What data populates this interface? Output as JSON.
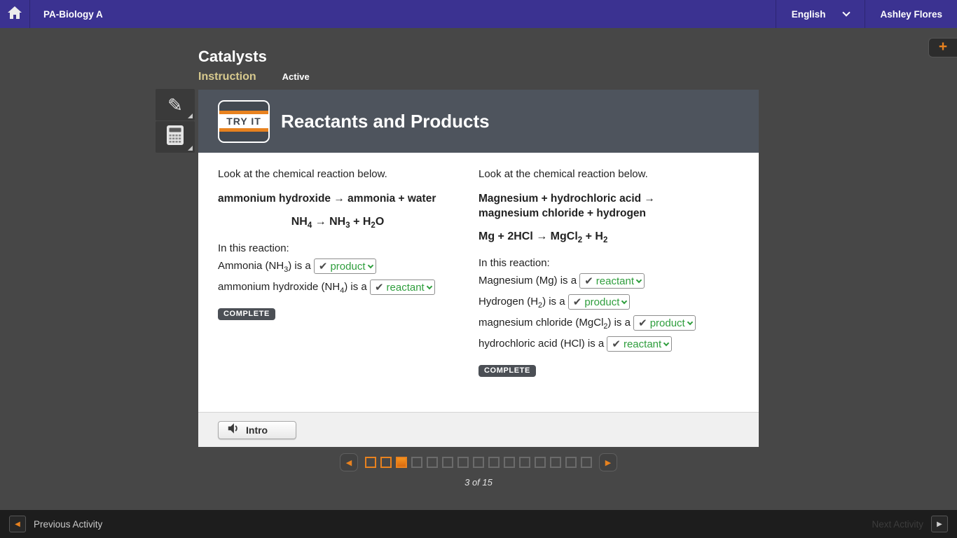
{
  "topbar": {
    "course_title": "PA-Biology A",
    "language": "English",
    "user_name": "Ashley Flores"
  },
  "lesson": {
    "title": "Catalysts",
    "tabs": [
      {
        "label": "Instruction",
        "active": true
      },
      {
        "label": "Active",
        "active": false
      }
    ]
  },
  "icons": {
    "pencil": "✎",
    "check": "✔",
    "prev_arrow": "◀",
    "next_arrow": "▶",
    "plus": "+"
  },
  "activity": {
    "badge": "TRY IT",
    "title": "Reactants and Products",
    "left": {
      "intro": "Look at the chemical reaction below.",
      "word_equation_lines": [
        "ammonium hydroxide  →  ammonia + water"
      ],
      "formula": [
        {
          "t": "NH"
        },
        {
          "t": "4",
          "sub": true
        },
        {
          "t": " → NH"
        },
        {
          "t": "3",
          "sub": true
        },
        {
          "t": " + H"
        },
        {
          "t": "2",
          "sub": true
        },
        {
          "t": "O"
        }
      ],
      "prompt": "In this reaction:",
      "rows": [
        {
          "segments": [
            {
              "t": "Ammonia (NH"
            },
            {
              "t": "3",
              "sub": true
            },
            {
              "t": ") is a "
            }
          ],
          "value": "product"
        },
        {
          "segments": [
            {
              "t": "ammonium hydroxide (NH"
            },
            {
              "t": "4",
              "sub": true
            },
            {
              "t": ") is a "
            }
          ],
          "value": "reactant"
        }
      ],
      "complete_label": "COMPLETE"
    },
    "right": {
      "intro": "Look at the chemical reaction below.",
      "word_equation_lines": [
        "Magnesium + hydrochloric acid  →",
        "magnesium chloride + hydrogen"
      ],
      "formula": [
        {
          "t": "Mg + 2HCl  →  MgCl"
        },
        {
          "t": "2",
          "sub": true
        },
        {
          "t": " + H"
        },
        {
          "t": "2",
          "sub": true
        }
      ],
      "prompt": "In this reaction:",
      "rows": [
        {
          "segments": [
            {
              "t": "Magnesium (Mg) is a "
            }
          ],
          "value": "reactant"
        },
        {
          "segments": [
            {
              "t": "Hydrogen (H"
            },
            {
              "t": "2",
              "sub": true
            },
            {
              "t": ") is a "
            }
          ],
          "value": "product"
        },
        {
          "segments": [
            {
              "t": "magnesium chloride (MgCl"
            },
            {
              "t": "2",
              "sub": true
            },
            {
              "t": ") is a "
            }
          ],
          "value": "product"
        },
        {
          "segments": [
            {
              "t": "hydrochloric acid (HCl) is a "
            }
          ],
          "value": "reactant"
        }
      ],
      "complete_label": "COMPLETE"
    }
  },
  "audio": {
    "intro_label": "Intro"
  },
  "pagination": {
    "total": 15,
    "current": 3,
    "label": "3 of 15"
  },
  "bottombar": {
    "previous_label": "Previous Activity",
    "next_label": "Next Activity"
  },
  "colors": {
    "topbar_purple": "#3b3291",
    "header_slate": "#4e545d",
    "accent_orange": "#e8821f",
    "dropdown_green": "#2f9e3d",
    "background_gray": "#474747"
  }
}
